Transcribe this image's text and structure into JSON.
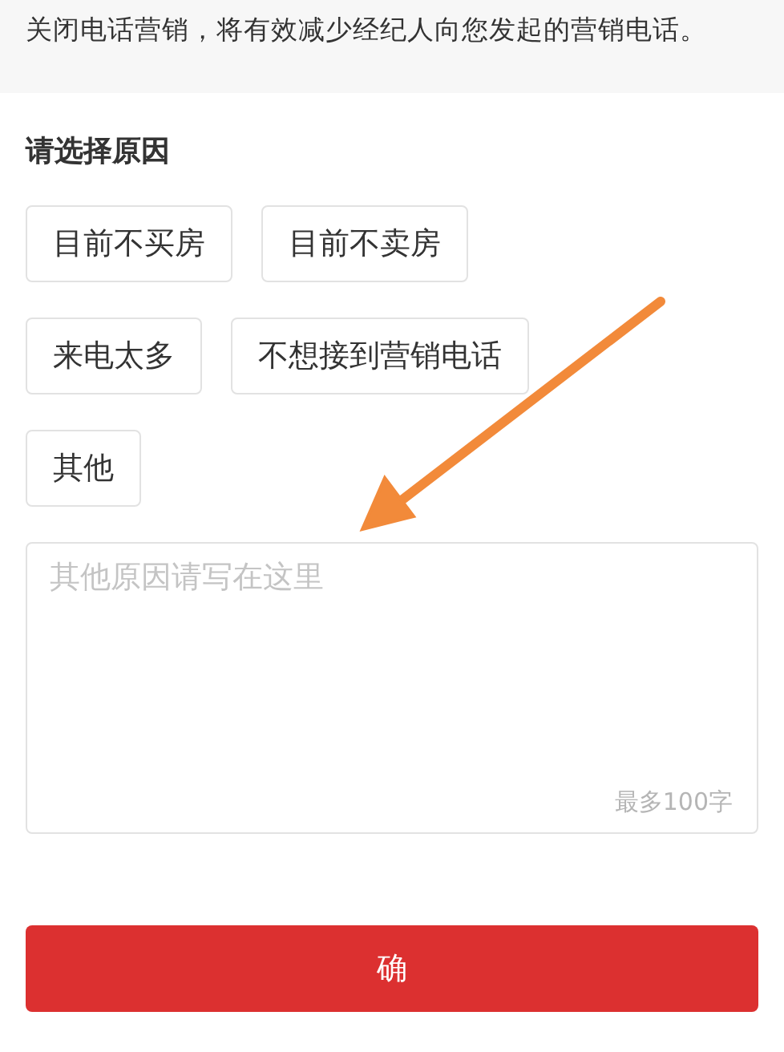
{
  "notice": {
    "text": "关闭电话营销，将有效减少经纪人向您发起的营销电话。"
  },
  "reasons": {
    "title": "请选择原因",
    "options": [
      {
        "label": "目前不买房",
        "selected": false
      },
      {
        "label": "目前不卖房",
        "selected": false
      },
      {
        "label": "来电太多",
        "selected": false
      },
      {
        "label": "不想接到营销电话",
        "selected": false
      },
      {
        "label": "其他",
        "selected": false
      }
    ]
  },
  "comment": {
    "placeholder": "其他原因请写在这里",
    "limit": "最多100字"
  },
  "submit": {
    "label": "确"
  }
}
